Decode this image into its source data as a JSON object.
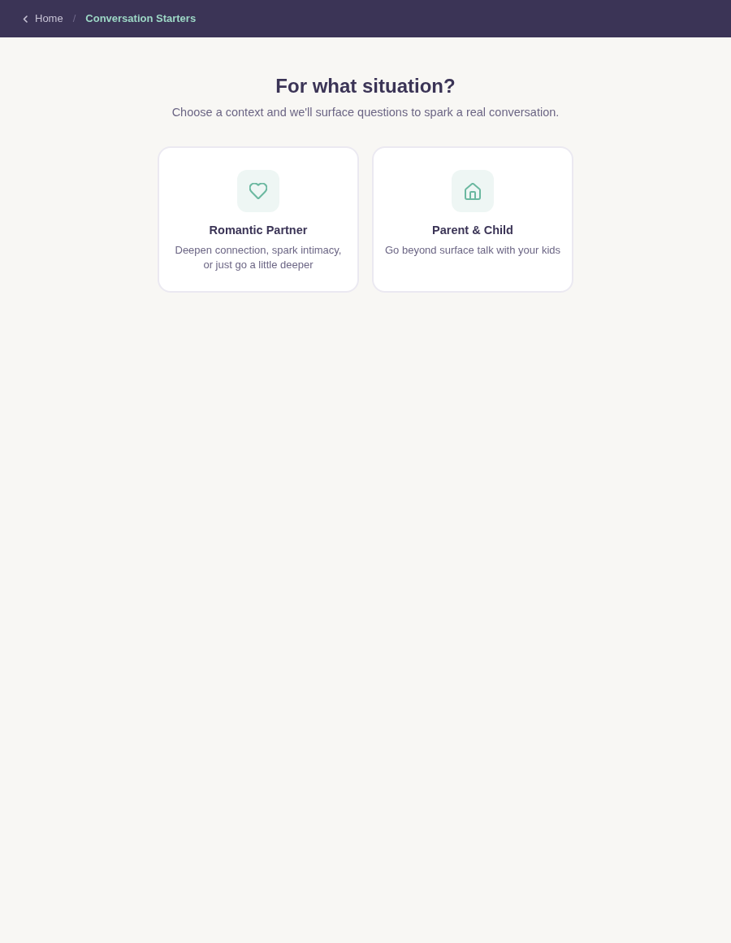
{
  "breadcrumb": {
    "back": "Home",
    "separator": "/",
    "current": "Conversation Starters"
  },
  "heading": {
    "title": "For what situation?",
    "subtitle": "Choose a context and we'll surface questions to spark a real conversation."
  },
  "options": [
    {
      "title": "Romantic Partner",
      "description": "Deepen connection, spark intimacy, or just go a little deeper"
    },
    {
      "title": "Parent & Child",
      "description": "Go beyond surface talk with your kids"
    }
  ]
}
